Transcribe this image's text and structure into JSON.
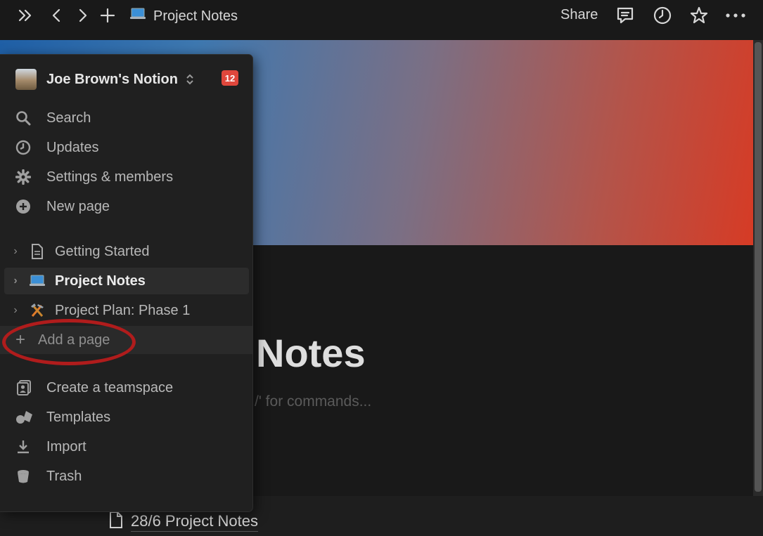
{
  "topbar": {
    "page_title": "Project Notes",
    "share_label": "Share"
  },
  "sidebar": {
    "workspace_name": "Joe Brown's Notion",
    "notification_count": "12",
    "nav": [
      {
        "label": "Search",
        "icon": "search-icon"
      },
      {
        "label": "Updates",
        "icon": "clock-icon"
      },
      {
        "label": "Settings & members",
        "icon": "gear-icon"
      },
      {
        "label": "New page",
        "icon": "plus-circle-icon"
      }
    ],
    "pages": [
      {
        "label": "Getting Started",
        "icon": "document-icon"
      },
      {
        "label": "Project Notes",
        "icon": "laptop-icon",
        "active": true
      },
      {
        "label": "Project Plan: Phase 1",
        "icon": "hammer-pick-icon"
      }
    ],
    "add_page_label": "Add a page",
    "footer": [
      {
        "label": "Create a teamspace",
        "icon": "teamspace-icon"
      },
      {
        "label": "Templates",
        "icon": "templates-icon"
      },
      {
        "label": "Import",
        "icon": "download-icon"
      },
      {
        "label": "Trash",
        "icon": "trash-icon"
      }
    ]
  },
  "page": {
    "title_visible": "Notes",
    "placeholder_visible": "/' for commands...",
    "subpage_label": "28/6 Project Notes"
  },
  "colors": {
    "highlight_ring": "#b01c1c",
    "badge": "#e0473c"
  }
}
